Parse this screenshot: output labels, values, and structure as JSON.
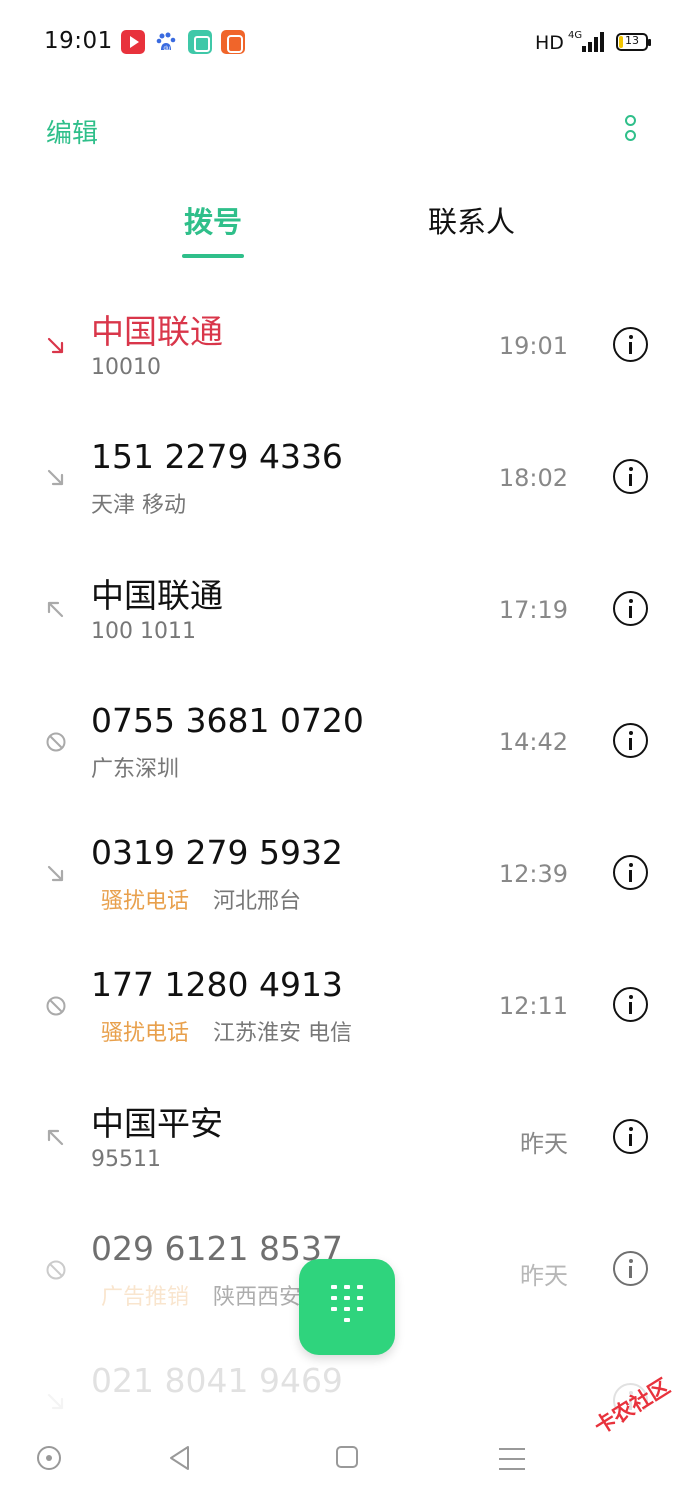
{
  "status_bar": {
    "time": "19:01",
    "hd": "HD",
    "network": "4G",
    "battery_level": 13,
    "battery_text": "13",
    "notification_icons": [
      "video-app-icon",
      "baidu-icon",
      "gallery-app-icon",
      "kuaishou-icon"
    ]
  },
  "header": {
    "edit_label": "编辑",
    "more_icon": "more-vertical-icon"
  },
  "tabs": [
    {
      "label": "拨号",
      "active": true
    },
    {
      "label": "联系人",
      "active": false
    }
  ],
  "calls": [
    {
      "name": "中国联通",
      "sub": "10010",
      "tag": "",
      "time": "19:01",
      "type": "missed"
    },
    {
      "name": "151 2279 4336",
      "sub": "天津 移动",
      "tag": "",
      "time": "18:02",
      "type": "incoming"
    },
    {
      "name": "中国联通",
      "sub": "100 1011",
      "tag": "",
      "time": "17:19",
      "type": "outgoing"
    },
    {
      "name": "0755 3681 0720",
      "sub": "广东深圳",
      "tag": "",
      "time": "14:42",
      "type": "blocked"
    },
    {
      "name": "0319 279 5932",
      "sub": "河北邢台",
      "tag": "骚扰电话",
      "time": "12:39",
      "type": "incoming"
    },
    {
      "name": "177 1280 4913",
      "sub": "江苏淮安 电信",
      "tag": "骚扰电话",
      "time": "12:11",
      "type": "blocked"
    },
    {
      "name": "中国平安",
      "sub": "95511",
      "tag": "",
      "time": "昨天",
      "type": "outgoing"
    },
    {
      "name": "029 6121 8537",
      "sub": "陕西西安",
      "tag": "广告推销",
      "time": "昨天",
      "type": "blocked"
    },
    {
      "name": "021 8041 9469",
      "sub": "",
      "tag": "",
      "time": "",
      "type": "incoming"
    }
  ],
  "fab": {
    "icon": "dialpad-icon"
  },
  "nav": [
    "recent-apps-icon",
    "back-icon",
    "home-icon",
    "menu-icon"
  ],
  "watermark": "卡农社区",
  "colors": {
    "accent": "#2fbf8a",
    "fab": "#2fd47d",
    "missed": "#d9364a",
    "spam_tag": "#e8a04c"
  }
}
